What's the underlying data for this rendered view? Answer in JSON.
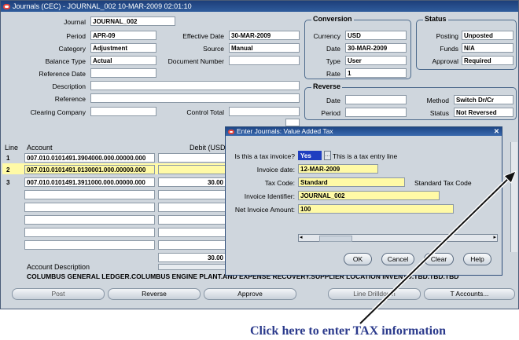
{
  "window": {
    "title": "Journals (CEC) - JOURNAL_002 10-MAR-2009 02:01:10"
  },
  "header": {
    "journal_label": "Journal",
    "journal_value": "JOURNAL_002",
    "period_label": "Period",
    "period_value": "APR-09",
    "category_label": "Category",
    "category_value": "Adjustment",
    "balance_type_label": "Balance Type",
    "balance_type_value": "Actual",
    "reference_date_label": "Reference Date",
    "reference_date_value": "",
    "description_label": "Description",
    "description_value": "",
    "reference_label": "Reference",
    "reference_value": "",
    "clearing_company_label": "Clearing Company",
    "clearing_company_value": "",
    "effective_date_label": "Effective Date",
    "effective_date_value": "30-MAR-2009",
    "source_label": "Source",
    "source_value": "Manual",
    "document_number_label": "Document Number",
    "document_number_value": "",
    "control_total_label": "Control Total",
    "control_total_value": ""
  },
  "conversion": {
    "title": "Conversion",
    "currency_label": "Currency",
    "currency_value": "USD",
    "date_label": "Date",
    "date_value": "30-MAR-2009",
    "type_label": "Type",
    "type_value": "User",
    "rate_label": "Rate",
    "rate_value": "1"
  },
  "status": {
    "title": "Status",
    "posting_label": "Posting",
    "posting_value": "Unposted",
    "funds_label": "Funds",
    "funds_value": "N/A",
    "approval_label": "Approval",
    "approval_value": "Required"
  },
  "reverse": {
    "title": "Reverse",
    "date_label": "Date",
    "date_value": "",
    "period_label": "Period",
    "period_value": "",
    "method_label": "Method",
    "method_value": "Switch Dr/Cr",
    "status_label": "Status",
    "status_value": "Not Reversed"
  },
  "lines": {
    "line_header": "Line",
    "account_header": "Account",
    "debit_header": "Debit (USD)",
    "rows": [
      {
        "line": "1",
        "account": "007.010.0101491.3904000.000.00000.000",
        "debit": ""
      },
      {
        "line": "2",
        "account": "007.010.0101491.0130001.000.00000.000",
        "debit": ""
      },
      {
        "line": "3",
        "account": "007.010.0101491.3911000.000.00000.000",
        "debit": "30.00"
      }
    ],
    "total_debit": "30.00",
    "account_description_label": "Account Description",
    "account_description_value": "COLUMBUS GENERAL LEDGER.COLUMBUS ENGINE PLANT.AND EXPENSE RECOVERY.SUPPLIER LOCATION INVENTO.TBD.TBD.TBD"
  },
  "buttons": {
    "post": "Post",
    "reverse": "Reverse",
    "approve": "Approve",
    "line_drilldown": "Line Drilldown",
    "t_accounts": "T Accounts..."
  },
  "dialog": {
    "title": "Enter Journals: Value Added Tax",
    "is_tax_invoice_label": "Is this a tax invoice?",
    "is_tax_invoice_value": "Yes",
    "tax_entry_note": "This is a tax entry line",
    "invoice_date_label": "Invoice date:",
    "invoice_date_value": "12-MAR-2009",
    "tax_code_label": "Tax Code:",
    "tax_code_value": "Standard",
    "tax_code_desc": "Standard Tax Code",
    "invoice_identifier_label": "Invoice Identifier:",
    "invoice_identifier_value": "JOURNAL_002",
    "net_invoice_amount_label": "Net Invoice Amount:",
    "net_invoice_amount_value": "100",
    "ok": "OK",
    "cancel": "Cancel",
    "clear": "Clear",
    "help": "Help"
  },
  "annotation": {
    "text": "Click here to enter TAX information"
  },
  "colors": {
    "titlebar": "#1d3f7a",
    "required_field": "#fffaa6",
    "callout": "#2b3a8c"
  }
}
